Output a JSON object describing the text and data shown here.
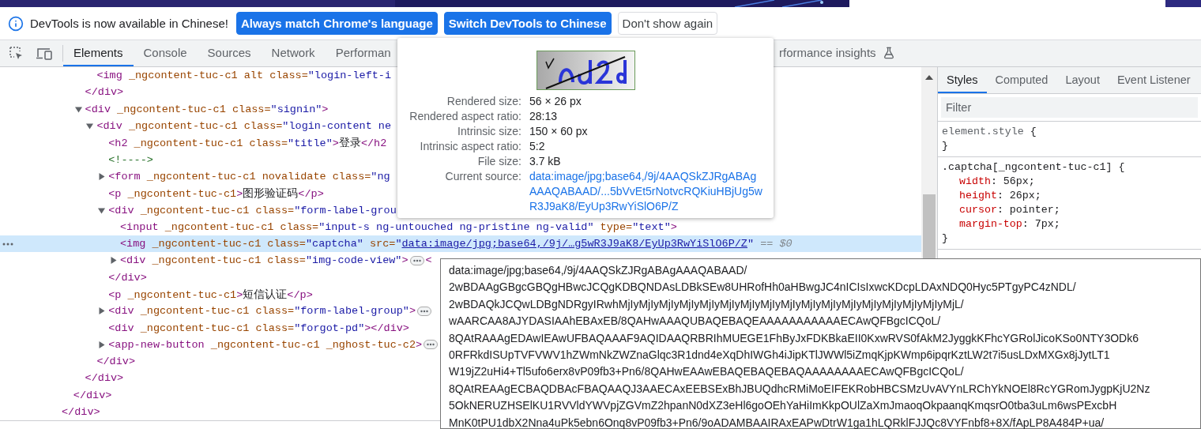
{
  "infobar": {
    "message": "DevTools is now available in Chinese!",
    "buttons": [
      {
        "label": "Always match Chrome's language",
        "kind": "primary"
      },
      {
        "label": "Switch DevTools to Chinese",
        "kind": "primary"
      },
      {
        "label": "Don't show again",
        "kind": "secondary"
      }
    ]
  },
  "toolbar": {
    "tabs": [
      {
        "label": "Elements",
        "selected": true
      },
      {
        "label": "Console",
        "selected": false
      },
      {
        "label": "Sources",
        "selected": false
      },
      {
        "label": "Network",
        "selected": false
      },
      {
        "label": "Performan",
        "selected": false
      },
      {
        "label": "rformance insights",
        "selected": false,
        "kind": "experimental"
      }
    ]
  },
  "dom_tree": [
    {
      "close": [
        {
          "kind": "tag",
          "text": "</div>"
        }
      ],
      "children": [
        {
          "close": [
            {
              "kind": "tag",
              "text": "</div>"
            }
          ],
          "children": [
            {
              "close": [
                {
                  "kind": "tag",
                  "text": "</div>"
                }
              ],
              "children": [
                {
                  "selected": false,
                  "open": [
                    {
                      "kind": "tag",
                      "text": "<img"
                    },
                    {
                      "kind": "attr",
                      "text": " _ngcontent-tuc-c1 alt class="
                    },
                    {
                      "kind": "value",
                      "text": "\"login-left-i"
                    }
                  ]
                }
              ]
            },
            {
              "selected": false,
              "expanded": true,
              "open": [
                {
                  "kind": "tag",
                  "text": "<div"
                },
                {
                  "kind": "attr",
                  "text": " _ngcontent-tuc-c1 class="
                },
                {
                  "kind": "value",
                  "text": "\"signin\""
                },
                {
                  "kind": "tag",
                  "text": ">"
                }
              ],
              "close": [
                {
                  "kind": "tag",
                  "text": "</div>"
                }
              ],
              "children": [
                {
                  "selected": false,
                  "expanded": true,
                  "open": [
                    {
                      "kind": "tag",
                      "text": "<div"
                    },
                    {
                      "kind": "attr",
                      "text": " _ngcontent-tuc-c1 class="
                    },
                    {
                      "kind": "value",
                      "text": "\"login-content ne"
                    }
                  ],
                  "close": [
                    {
                      "kind": "tag",
                      "text": "</div>"
                    }
                  ],
                  "children": [
                    {
                      "selected": false,
                      "open": [
                        {
                          "kind": "tag",
                          "text": "<h2"
                        },
                        {
                          "kind": "attr",
                          "text": " _ngcontent-tuc-c1 class="
                        },
                        {
                          "kind": "value",
                          "text": "\"title\""
                        },
                        {
                          "kind": "tag",
                          "text": ">"
                        },
                        {
                          "kind": "text",
                          "text": "登录"
                        },
                        {
                          "kind": "tag",
                          "text": "</h2"
                        }
                      ]
                    },
                    {
                      "selected": false,
                      "open": [
                        {
                          "kind": "comment",
                          "text": "<!---->"
                        }
                      ]
                    },
                    {
                      "selected": false,
                      "expanded": false,
                      "open": [
                        {
                          "kind": "tag",
                          "text": "<form"
                        },
                        {
                          "kind": "attr",
                          "text": " _ngcontent-tuc-c1 novalidate class="
                        },
                        {
                          "kind": "value",
                          "text": "\"ng"
                        }
                      ]
                    },
                    {
                      "selected": false,
                      "open": [
                        {
                          "kind": "tag",
                          "text": "<p"
                        },
                        {
                          "kind": "attr",
                          "text": " _ngcontent-tuc-c1"
                        },
                        {
                          "kind": "tag",
                          "text": ">"
                        },
                        {
                          "kind": "text",
                          "text": "图形验证码"
                        },
                        {
                          "kind": "tag",
                          "text": "</p>"
                        }
                      ]
                    },
                    {
                      "selected": false,
                      "expanded": true,
                      "open": [
                        {
                          "kind": "tag",
                          "text": "<div"
                        },
                        {
                          "kind": "attr",
                          "text": " _ngcontent-tuc-c1 class="
                        },
                        {
                          "kind": "value",
                          "text": "\"form-label-grou"
                        }
                      ],
                      "close": [
                        {
                          "kind": "tag",
                          "text": "</div>"
                        }
                      ],
                      "children": [
                        {
                          "selected": false,
                          "open": [
                            {
                              "kind": "tag",
                              "text": "<input"
                            },
                            {
                              "kind": "attr",
                              "text": " _ngcontent-tuc-c1 class="
                            },
                            {
                              "kind": "value",
                              "text": "\"input-s ng-untouched ng-pristine ng-valid\""
                            },
                            {
                              "kind": "attr",
                              "text": " type="
                            },
                            {
                              "kind": "value",
                              "text": "\"text\""
                            },
                            {
                              "kind": "tag",
                              "text": ">"
                            }
                          ]
                        },
                        {
                          "selected": true,
                          "open": [
                            {
                              "kind": "tag",
                              "text": "<img"
                            },
                            {
                              "kind": "attr",
                              "text": " _ngcontent-tuc-c1 class="
                            },
                            {
                              "kind": "value",
                              "text": "\"captcha\""
                            },
                            {
                              "kind": "attr",
                              "text": " src="
                            },
                            {
                              "kind": "value",
                              "text": "\""
                            },
                            {
                              "kind": "link",
                              "text": "data:image/jpg;base64,/9j/…g5wR3J9aK8/EyUp3RwYiSlO6P/Z"
                            },
                            {
                              "kind": "value",
                              "text": "\""
                            },
                            {
                              "kind": "hint",
                              "text": " == $0"
                            }
                          ]
                        },
                        {
                          "selected": false,
                          "expanded": false,
                          "open": [
                            {
                              "kind": "tag",
                              "text": "<div"
                            },
                            {
                              "kind": "attr",
                              "text": " _ngcontent-tuc-c1 class="
                            },
                            {
                              "kind": "value",
                              "text": "\"img-code-view\""
                            },
                            {
                              "kind": "tag",
                              "text": ">"
                            },
                            {
                              "kind": "badge"
                            },
                            {
                              "kind": "tag",
                              "text": "<"
                            }
                          ]
                        }
                      ]
                    },
                    {
                      "selected": false,
                      "open": [
                        {
                          "kind": "tag",
                          "text": "<p"
                        },
                        {
                          "kind": "attr",
                          "text": " _ngcontent-tuc-c1"
                        },
                        {
                          "kind": "tag",
                          "text": ">"
                        },
                        {
                          "kind": "text",
                          "text": "短信认证"
                        },
                        {
                          "kind": "tag",
                          "text": "</p>"
                        }
                      ]
                    },
                    {
                      "selected": false,
                      "expanded": false,
                      "open": [
                        {
                          "kind": "tag",
                          "text": "<div"
                        },
                        {
                          "kind": "attr",
                          "text": " _ngcontent-tuc-c1 class="
                        },
                        {
                          "kind": "value",
                          "text": "\"form-label-group\""
                        },
                        {
                          "kind": "tag",
                          "text": ">"
                        },
                        {
                          "kind": "badge"
                        }
                      ]
                    },
                    {
                      "selected": false,
                      "open": [
                        {
                          "kind": "tag",
                          "text": "<div"
                        },
                        {
                          "kind": "attr",
                          "text": " _ngcontent-tuc-c1 class="
                        },
                        {
                          "kind": "value",
                          "text": "\"forgot-pd\""
                        },
                        {
                          "kind": "tag",
                          "text": "></div>"
                        }
                      ]
                    },
                    {
                      "selected": false,
                      "expanded": false,
                      "open": [
                        {
                          "kind": "tag",
                          "text": "<app-new-button"
                        },
                        {
                          "kind": "attr",
                          "text": " _ngcontent-tuc-c1 _nghost-tuc-c2"
                        },
                        {
                          "kind": "tag",
                          "text": ">"
                        },
                        {
                          "kind": "badge"
                        }
                      ]
                    }
                  ]
                }
              ]
            }
          ]
        }
      ]
    }
  ],
  "styles_pane": {
    "tabs": [
      {
        "label": "Styles",
        "selected": true
      },
      {
        "label": "Computed",
        "selected": false
      },
      {
        "label": "Layout",
        "selected": false
      },
      {
        "label": "Event Listener",
        "selected": false
      }
    ],
    "filter": {
      "placeholder": "Filter"
    },
    "rules": [
      {
        "kind": "inline",
        "selector": "element.style",
        "open": "{",
        "close": "}"
      },
      {
        "kind": "normal",
        "selector": ".captcha[_ngcontent-tuc-c1]",
        "open": "{",
        "close": "}",
        "declarations": [
          {
            "property": "width",
            "value": ": 56px;"
          },
          {
            "property": "height",
            "value": ": 26px;"
          },
          {
            "property": "cursor",
            "value": ": pointer;"
          },
          {
            "property": "margin-top",
            "value": ": 7px;"
          }
        ]
      }
    ]
  },
  "image_preview": {
    "rows": [
      {
        "label": "Rendered size:",
        "value": "56 × 26 px"
      },
      {
        "label": "Rendered aspect ratio:",
        "value": "28:13"
      },
      {
        "label": "Intrinsic size:",
        "value": "150 × 60 px"
      },
      {
        "label": "Intrinsic aspect ratio:",
        "value": "5:2"
      },
      {
        "label": "File size:",
        "value": "3.7 kB"
      },
      {
        "label": "Current source:",
        "value": "data:image/jpg;base64,/9j/4AAQSkZJRgABAgAAAQABAAD/...5bVvEt5rNotvcRQKiuHBjUg5wR3J9aK8/EyUp3RwYiSlO6P/Z",
        "kind": "link"
      }
    ]
  },
  "source_tooltip": {
    "lines": [
      "data:image/jpg;base64,/9j/4AAQSkZJRgABAgAAAQABAAD/",
      "2wBDAAgGBgcGBQgHBwcJCQgKDBQNDAsLDBkSEw8UHRofHh0aHBwgJC4nICIsIxwcKDcpLDAxNDQ0Hyc5PTgyPC4zNDL/",
      "2wBDAQkJCQwLDBgNDRgyIRwhMjIyMjIyMjIyMjIyMjIyMjIyMjIyMjIyMjIyMjIyMjIyMjIyMjIyMjIyMjIyMjIyMjL/",
      "wAARCAA8AJYDASIAAhEBAxEB/8QAHwAAAQUBAQEBAQEAAAAAAAAAAAECAwQFBgcICQoL/",
      "8QAtRAAAgEDAwIEAwUFBAQAAAF9AQIDAAQRBRIhMUEGE1FhByJxFDKBkaEII0KxwRVS0fAkM2JyggkKFhcYGRolJicoKSo0NTY3ODk6",
      "0RFRkdISUpTVFVWV1hZWmNkZWZnaGlqc3R1dnd4eXqDhIWGh4iJipKTlJWWl5iZmqKjpKWmp6ipqrKztLW2t7i5usLDxMXGx8jJytLT1",
      "W19jZ2uHi4+Tl5ufo6erx8vP09fb3+Pn6/8QAHwEAAwEBAQEBAQEBAQAAAAAAAAECAwQFBgcICQoL/",
      "8QAtREAAgECBAQDBAcFBAQAAQJ3AAECAxEEBSExBhJBUQdhcRMiMoEIFEKRobHBCSMzUvAVYnLRChYkNOEl8RcYGRomJygpKjU2Nz",
      "5OkNERUZHSElKU1RVVldYWVpjZGVmZ2hpanN0dXZ3eHl6goOEhYaHiImKkpOUlZaXmJmaoqOkpaanqKmqsrO0tba3uLm6wsPExcbH",
      "MnK0tPU1dbX2Nna4uPk5ebn6Onq8vP09fb3+Pn6/9oADAMBAAIRAxEAPwDtrW1ga1hLQRklFJJQc8VYFnbf8+8X/fApLP8A484P+ua/"
    ]
  }
}
